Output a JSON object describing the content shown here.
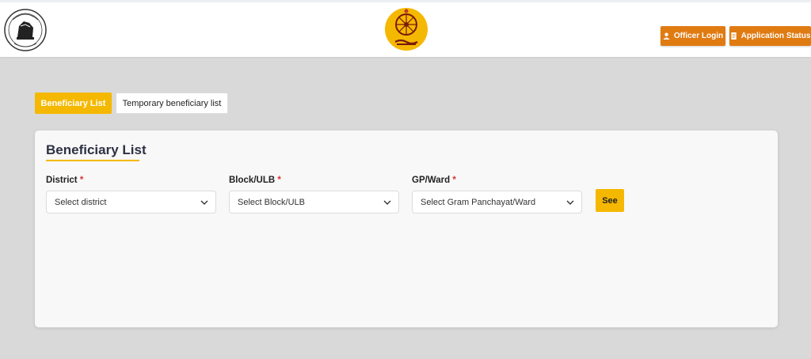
{
  "header": {
    "officer_login_label": "Officer Login",
    "application_status_label": "Application Status",
    "accent_color": "#e07b12"
  },
  "tabs": [
    {
      "label": "Beneficiary List",
      "active": true
    },
    {
      "label": "Temporary beneficiary list",
      "active": false
    }
  ],
  "card": {
    "title": "Beneficiary List",
    "fields": [
      {
        "label": "District",
        "required_mark": "*",
        "placeholder": "Select district"
      },
      {
        "label": "Block/ULB",
        "required_mark": "*",
        "placeholder": "Select Block/ULB"
      },
      {
        "label": "GP/Ward",
        "required_mark": "*",
        "placeholder": "Select Gram Panchayat/Ward"
      }
    ],
    "submit_label": "See"
  },
  "colors": {
    "primary_yellow": "#f5b800",
    "header_button_orange": "#e07b12",
    "required_red": "#e03131",
    "page_background": "#d9d9d9"
  },
  "icons": {
    "officer_login": "user-icon",
    "application_status": "document-icon",
    "select_chevron": "chevron-down-icon"
  }
}
